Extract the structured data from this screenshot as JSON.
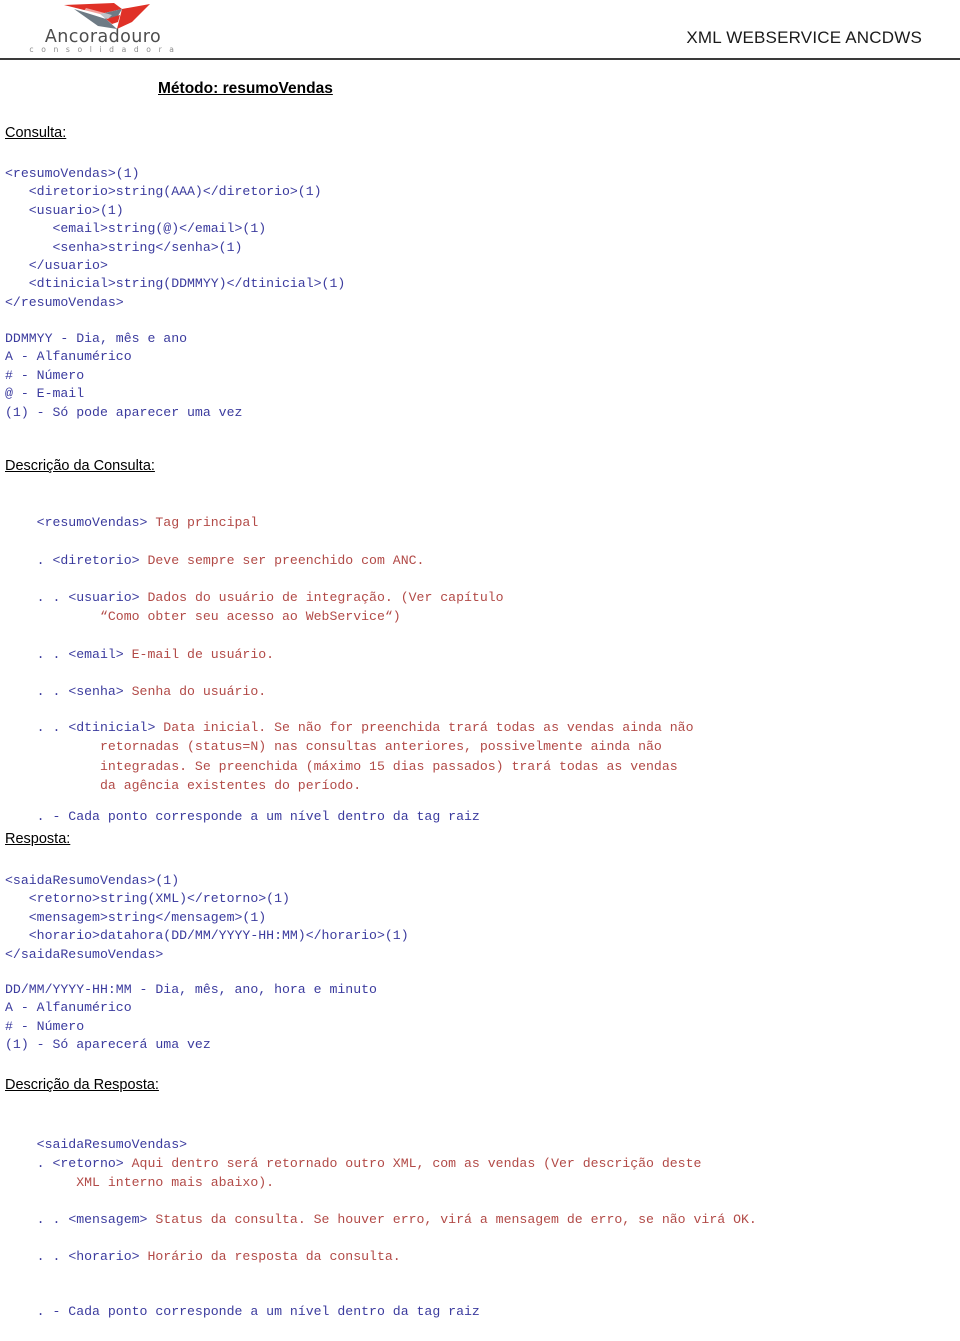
{
  "header": {
    "logo_word": "Ancoradouro",
    "logo_sub": "c o n s o l i d a d o r a",
    "logo_icon": "ancoradouro-bird-logo",
    "title": "XML WEBSERVICE ANCDWS",
    "brand_red": "#e03127",
    "brand_gray": "#6e7b85"
  },
  "page": {
    "method_title": "Método: resumoVendas"
  },
  "consulta": {
    "heading": "Consulta:",
    "code": "<resumoVendas>(1)\n   <diretorio>string(AAA)</diretorio>(1)\n   <usuario>(1)\n      <email>string(@)</email>(1)\n      <senha>string</senha>(1)\n   </usuario>\n   <dtinicial>string(DDMMYY)</dtinicial>(1)\n</resumoVendas>",
    "legend": "DDMMYY - Dia, mês e ano\nA - Alfanumérico\n# - Número\n@ - E-mail\n(1) - Só pode aparecer uma vez"
  },
  "descricao_consulta": {
    "heading": "Descrição da Consulta:",
    "items": [
      {
        "dots": "",
        "tag": "<resumoVendas>",
        "text": " Tag principal"
      },
      {
        "dots": ". ",
        "tag": "<diretorio>",
        "text": " Deve sempre ser preenchido com ANC."
      },
      {
        "dots": ". . ",
        "tag": "<usuario>",
        "text": " Dados do usuário de integração. (Ver capítulo\n            “Como obter seu acesso ao WebService“)"
      },
      {
        "dots": ". . ",
        "tag": "<email>",
        "text": " E-mail de usuário."
      },
      {
        "dots": ". . ",
        "tag": "<senha>",
        "text": " Senha do usuário."
      },
      {
        "dots": ". . ",
        "tag": "<dtinicial>",
        "text": " Data inicial. Se não for preenchida trará todas as vendas ainda não\n            retornadas (status=N) nas consultas anteriores, possivelmente ainda não\n            integradas. Se preenchida (máximo 15 dias passados) trará todas as vendas\n            da agência existentes do período."
      }
    ],
    "footnote": ". - Cada ponto corresponde a um nível dentro da tag raiz"
  },
  "resposta": {
    "heading": "Resposta:",
    "code": "<saidaResumoVendas>(1)\n   <retorno>string(XML)</retorno>(1)\n   <mensagem>string</mensagem>(1)\n   <horario>datahora(DD/MM/YYYY-HH:MM)</horario>(1)\n</saidaResumoVendas>",
    "legend": "DD/MM/YYYY-HH:MM - Dia, mês, ano, hora e minuto\nA - Alfanumérico\n# - Número\n(1) - Só aparecerá uma vez"
  },
  "descricao_resposta": {
    "heading": "Descrição da Resposta:",
    "items": [
      {
        "dots": "",
        "tag": "<saidaResumoVendas>",
        "text": ""
      },
      {
        "dots": ". ",
        "tag": "<retorno>",
        "text": " Aqui dentro será retornado outro XML, com as vendas (Ver descrição deste\n         XML interno mais abaixo)."
      },
      {
        "dots": ". . ",
        "tag": "<mensagem>",
        "text": " Status da consulta. Se houver erro, virá a mensagem de erro, se não virá OK."
      },
      {
        "dots": ". . ",
        "tag": "<horario>",
        "text": " Horário da resposta da consulta."
      }
    ],
    "footnote": ". - Cada ponto corresponde a um nível dentro da tag raiz"
  }
}
